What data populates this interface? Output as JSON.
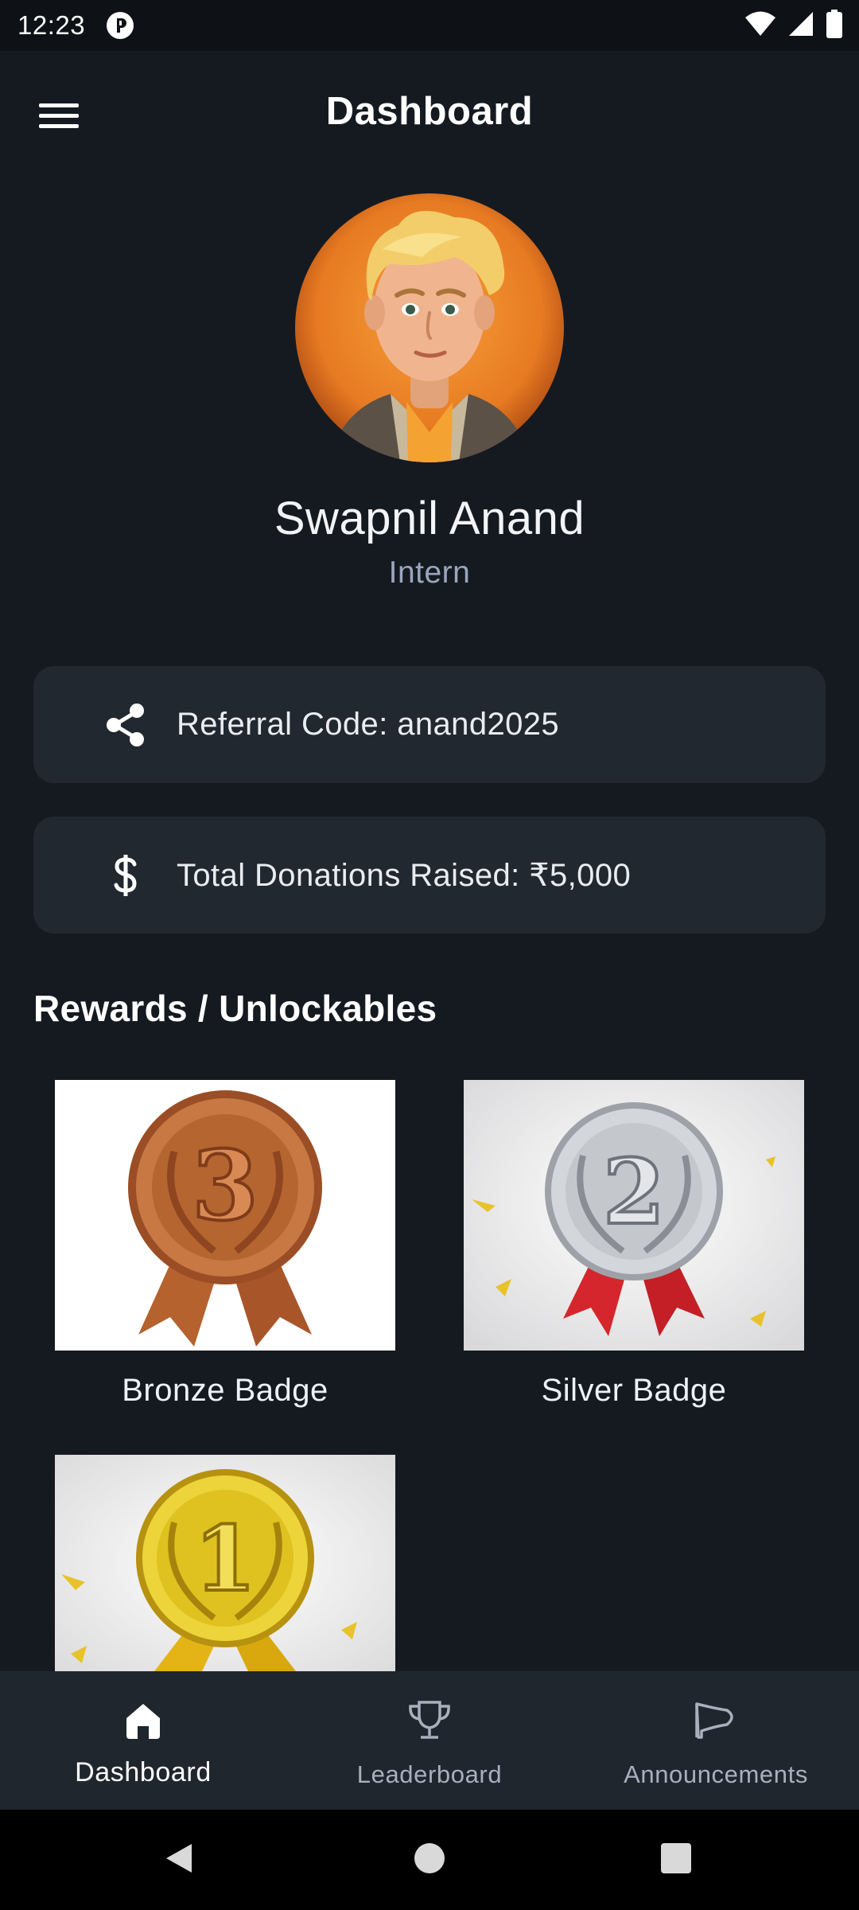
{
  "status_bar": {
    "time": "12:23",
    "icons": [
      "app-notification-icon",
      "wifi-icon",
      "signal-icon",
      "battery-icon"
    ]
  },
  "app_bar": {
    "title": "Dashboard",
    "menu_icon": "hamburger-menu-icon"
  },
  "profile": {
    "name": "Swapnil Anand",
    "role": "Intern",
    "avatar": "cartoon-avatar-blond-young-man"
  },
  "cards": {
    "referral": {
      "icon": "share-icon",
      "text": "Referral Code: anand2025"
    },
    "donations": {
      "icon": "dollar-icon",
      "text": "Total Donations Raised: ₹5,000"
    }
  },
  "rewards": {
    "title": "Rewards / Unlockables",
    "badges": [
      {
        "label": "Bronze Badge",
        "image": "bronze-medal-3"
      },
      {
        "label": "Silver Badge",
        "image": "silver-medal-2"
      },
      {
        "label": "",
        "image": "gold-medal-1"
      }
    ]
  },
  "bottom_nav": {
    "items": [
      {
        "label": "Dashboard",
        "icon": "home-icon",
        "active": true
      },
      {
        "label": "Leaderboard",
        "icon": "trophy-icon",
        "active": false
      },
      {
        "label": "Announcements",
        "icon": "megaphone-icon",
        "active": false
      }
    ]
  },
  "system_nav": {
    "buttons": [
      "back-icon",
      "home-circle-icon",
      "recents-icon"
    ]
  },
  "colors": {
    "background": "#151a21",
    "card": "#222830",
    "bottom_nav": "#20262e",
    "secondary_text": "#9aa6bc",
    "bronze": "#b86a3c",
    "silver": "#c9ccd1",
    "gold": "#e4c21f",
    "ribbon_red": "#d4262c"
  }
}
